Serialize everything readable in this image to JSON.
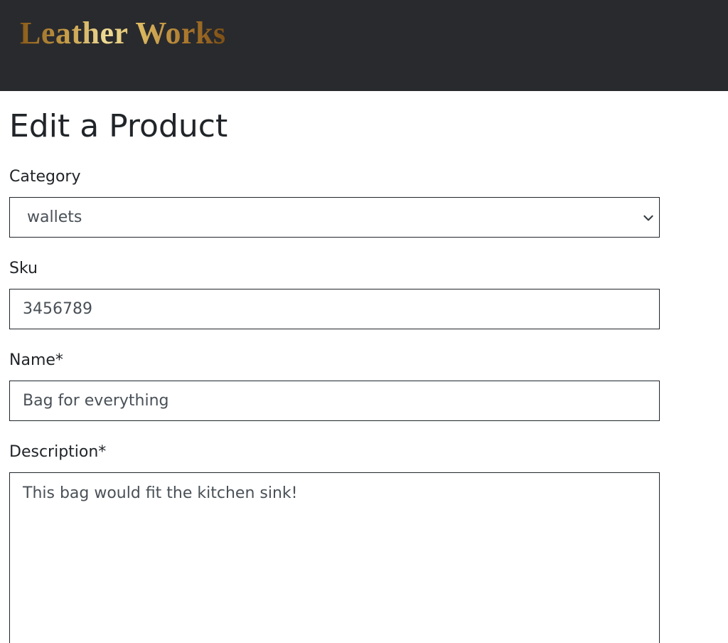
{
  "header": {
    "brand": "Leather Works"
  },
  "main": {
    "title": "Edit a Product",
    "form": {
      "category": {
        "label": "Category",
        "value": "wallets"
      },
      "sku": {
        "label": "Sku",
        "value": "3456789"
      },
      "name": {
        "label": "Name*",
        "value": "Bag for everything"
      },
      "description": {
        "label": "Description*",
        "value": "This bag would fit the kitchen sink!"
      }
    }
  },
  "icons": {
    "select_arrow": "chevron-down-icon"
  },
  "colors": {
    "header_bg": "#292a2d",
    "brand_gold": "#d9b45c",
    "text": "#212529",
    "input_text": "#495057",
    "border": "#212529"
  }
}
